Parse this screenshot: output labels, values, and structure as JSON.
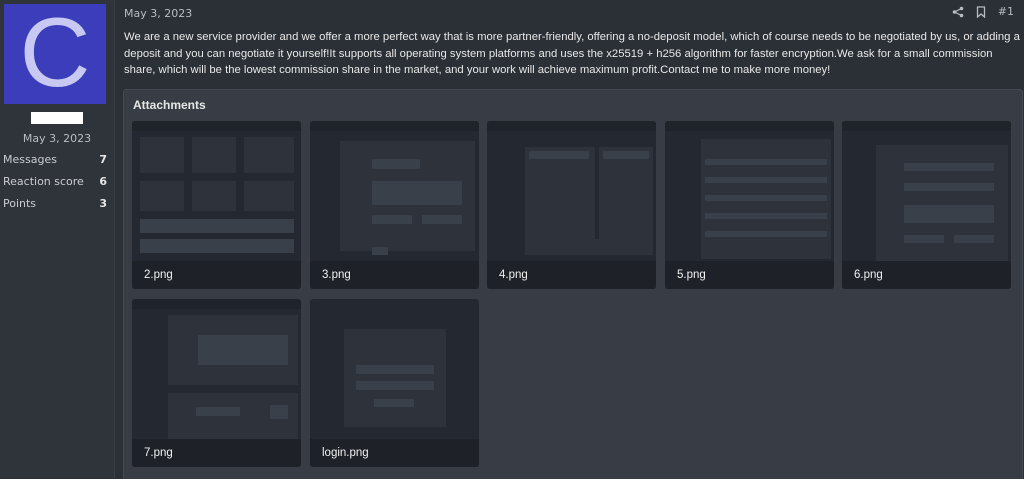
{
  "user": {
    "avatar_letter": "C",
    "join_date": "May 3, 2023",
    "stats": [
      {
        "label": "Messages",
        "value": "7"
      },
      {
        "label": "Reaction score",
        "value": "6"
      },
      {
        "label": "Points",
        "value": "3"
      }
    ]
  },
  "post": {
    "date": "May 3, 2023",
    "number": "#1",
    "body": "We are a new service provider and we offer a more perfect way that is more partner-friendly, offering a no-deposit model, which of course needs to be negotiated by us, or adding a deposit and you can negotiate it yourself!It supports all operating system platforms and uses the x25519 + h256 algorithm for faster encryption.We ask for a small commission share, which will be the lowest commission share in the market, and your work will achieve maximum profit.Contact me to make more money!"
  },
  "attachments": {
    "title": "Attachments",
    "files": [
      {
        "name": "2.png"
      },
      {
        "name": "3.png"
      },
      {
        "name": "4.png"
      },
      {
        "name": "5.png"
      },
      {
        "name": "6.png"
      },
      {
        "name": "7.png"
      },
      {
        "name": "login.png"
      }
    ]
  },
  "colors": {
    "avatar_bg": "#3c3dbb",
    "avatar_letter": "#c7c9f2",
    "page_bg": "#2b2f36",
    "attach_bg": "#383d45"
  },
  "icons": [
    "share-icon",
    "bookmark-icon"
  ]
}
